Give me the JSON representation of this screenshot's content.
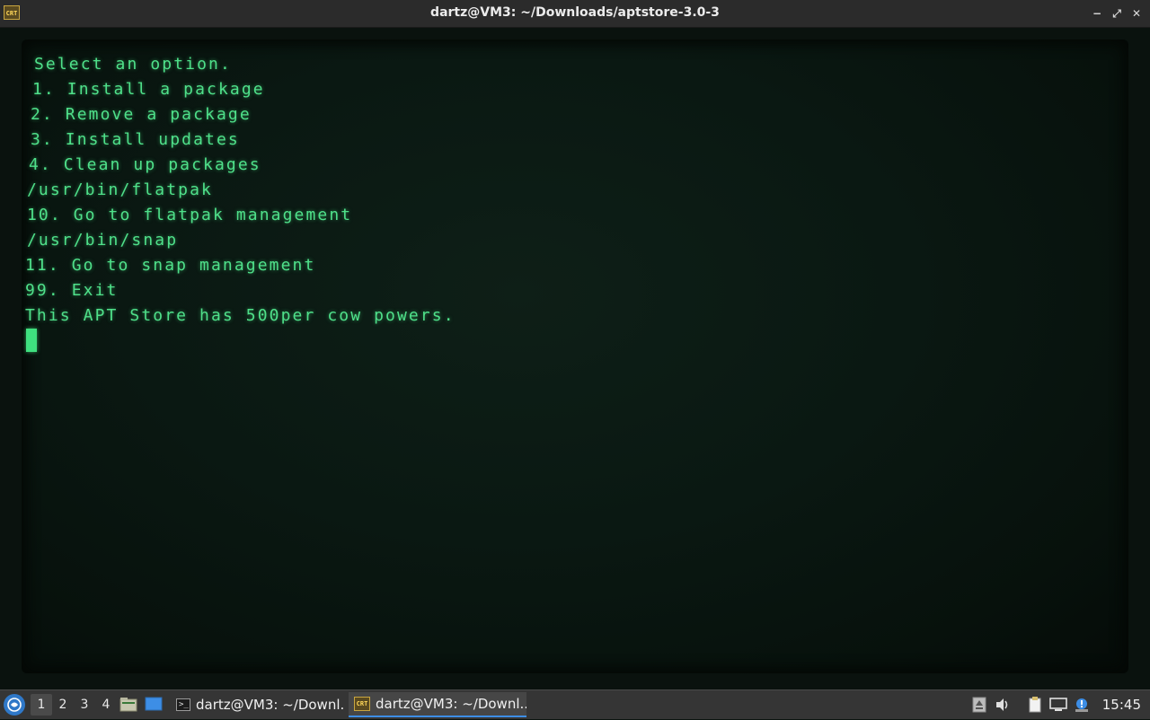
{
  "window": {
    "title": "dartz@VM3: ~/Downloads/aptstore-3.0-3",
    "app_icon_text": "CRT",
    "controls": {
      "minimize": "−",
      "maximize": "⤢",
      "close": "✕"
    }
  },
  "terminal": {
    "text_color": "#4fe08a",
    "lines": [
      "Select an option.",
      "1. Install a package",
      "2. Remove a package",
      "3. Install updates",
      "4. Clean up packages",
      "/usr/bin/flatpak",
      "10. Go to flatpak management",
      "/usr/bin/snap",
      "11. Go to snap management",
      "99. Exit",
      "This APT Store has 500per cow powers."
    ]
  },
  "taskbar": {
    "start_icon": "lxqt-start-icon",
    "desktops": [
      "1",
      "2",
      "3",
      "4"
    ],
    "active_desktop": "1",
    "quick_launch": [
      "file-manager-icon",
      "show-desktop-icon"
    ],
    "tasks": [
      {
        "label": "dartz@VM3: ~/Downl...",
        "icon": "terminal-icon",
        "icon_text": ">_",
        "active": false
      },
      {
        "label": "dartz@VM3: ~/Downl...",
        "icon": "cool-retro-term-icon",
        "icon_text": "CRT",
        "active": true
      }
    ],
    "tray": [
      "network-upload-icon",
      "volume-icon",
      "clipboard-icon",
      "network-icon",
      "update-notifier-icon"
    ],
    "clock": "15:45",
    "accent_color": "#3d8ee6"
  }
}
